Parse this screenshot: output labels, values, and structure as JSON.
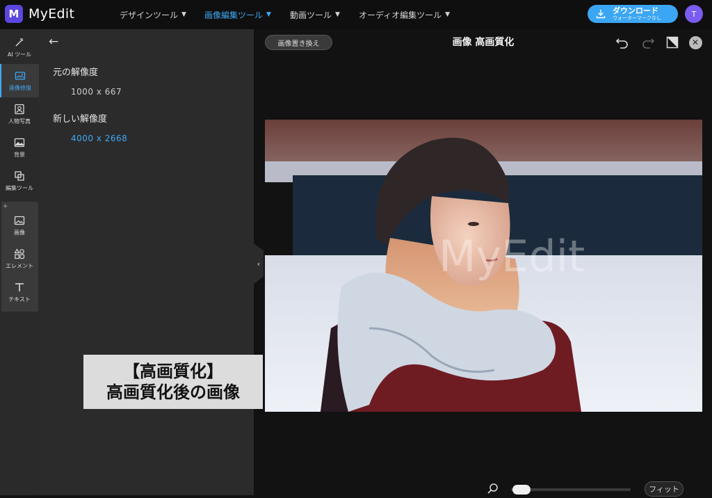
{
  "app": {
    "name": "MyEdit",
    "logo_letter": "M"
  },
  "nav": [
    {
      "label": "デザインツール"
    },
    {
      "label": "画像編集ツール"
    },
    {
      "label": "動画ツール"
    },
    {
      "label": "オーディオ編集ツール"
    }
  ],
  "download": {
    "label": "ダウンロード",
    "sublabel": "ウォーターマークなし"
  },
  "user": {
    "initial": "T"
  },
  "rail": [
    {
      "label": "AI ツール",
      "icon": "magic-wand-icon"
    },
    {
      "label": "画像修復",
      "icon": "image-repair-icon"
    },
    {
      "label": "人物写真",
      "icon": "portrait-icon"
    },
    {
      "label": "背景",
      "icon": "background-icon"
    },
    {
      "label": "編集ツール",
      "icon": "edit-tools-icon"
    },
    {
      "label": "画像",
      "icon": "image-icon"
    },
    {
      "label": "エレメント",
      "icon": "elements-icon"
    },
    {
      "label": "テキスト",
      "icon": "text-icon"
    }
  ],
  "panel": {
    "original_label": "元の解像度",
    "original_value": "1000 x 667",
    "new_label": "新しい解像度",
    "new_value": "4000 x 2668"
  },
  "caption": {
    "line1": "【高画質化】",
    "line2": "高画質化後の画像"
  },
  "editor": {
    "replace_button": "画像置き換え",
    "title": "画像 高画質化",
    "watermark": "MyEdit",
    "fit_button": "フィット"
  },
  "colors": {
    "accent": "#3fa9f5",
    "brand": "#5b47e0",
    "download": "#3ba6f3"
  }
}
